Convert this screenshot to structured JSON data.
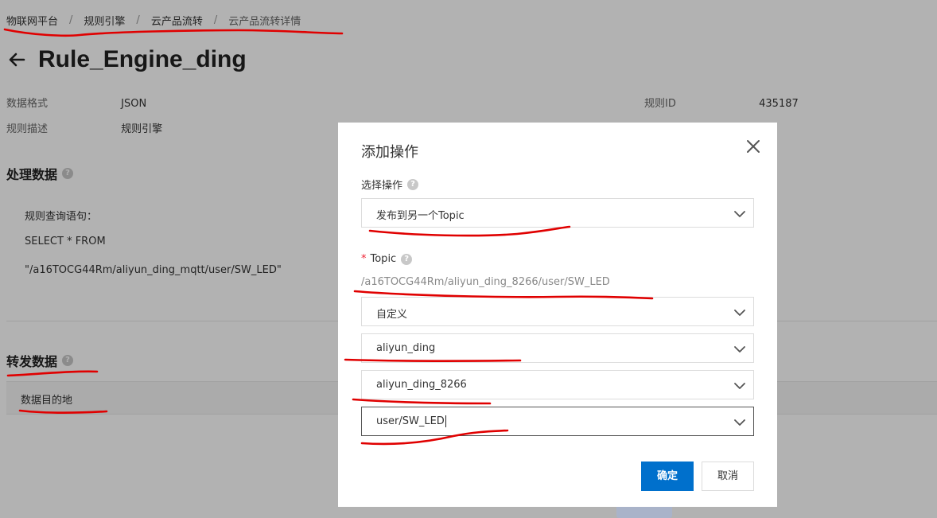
{
  "breadcrumb": [
    "物联网平台",
    "规则引擎",
    "云产品流转",
    "云产品流转详情"
  ],
  "breadcrumb_sep": "/",
  "title": "Rule_Engine_ding",
  "info": {
    "format_label": "数据格式",
    "format_value": "JSON",
    "desc_label": "规则描述",
    "desc_value": "规则引擎",
    "id_label": "规则ID",
    "id_value": "435187"
  },
  "process": {
    "title": "处理数据",
    "query_label": "规则查询语句：",
    "query_line1": "SELECT * FROM",
    "query_line2": "\"/a16TOCG44Rm/aliyun_ding_mqtt/user/SW_LED\""
  },
  "forward": {
    "title": "转发数据",
    "tab_label": "数据目的地"
  },
  "modal": {
    "title": "添加操作",
    "op_label": "选择操作",
    "op_value": "发布到另一个Topic",
    "required_mark": "*",
    "topic_label": "Topic",
    "topic_preview": "/a16TOCG44Rm/aliyun_ding_8266/user/SW_LED",
    "topic_type": "自定义",
    "product": "aliyun_ding",
    "device": "aliyun_ding_8266",
    "topic_path": "user/SW_LED",
    "ok_label": "确定",
    "cancel_label": "取消"
  },
  "help_glyph": "?",
  "icons": {
    "back": "arrow-left-icon",
    "close": "close-icon",
    "dropdown": "chevron-down-icon",
    "help": "question-circle-icon"
  },
  "colors": {
    "primary": "#0070cc",
    "annotation": "#e00000",
    "required": "#ee2233"
  }
}
